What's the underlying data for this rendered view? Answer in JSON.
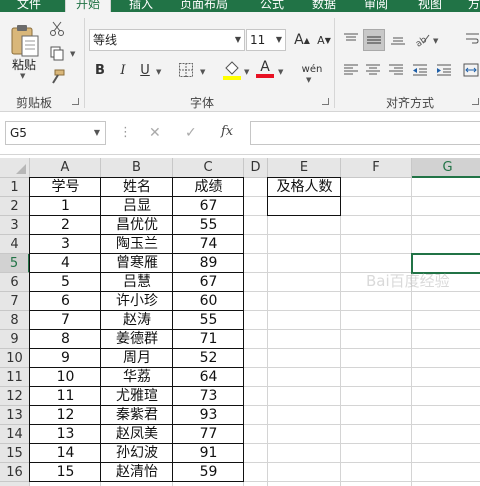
{
  "tabs": [
    "文件",
    "开始",
    "插入",
    "页面布局",
    "公式",
    "数据",
    "审阅",
    "视图",
    "方"
  ],
  "active_tab": "开始",
  "ribbon": {
    "clipboard_label": "剪贴板",
    "paste_label": "粘贴",
    "font_label": "字体",
    "align_label": "对齐方式",
    "font_name": "等线",
    "font_size": "11",
    "bold": "B",
    "italic": "I",
    "underline": "U",
    "font_color_glyph": "A",
    "phonetic_glyph": "wén",
    "grow_glyph": "A",
    "shrink_glyph": "A",
    "font_color": "#e81123",
    "fill_color": "#ffff00"
  },
  "formula_bar": {
    "name_box": "G5",
    "cancel": "✕",
    "enter": "✓",
    "fx": "fx",
    "formula": ""
  },
  "columns": [
    "A",
    "B",
    "C",
    "D",
    "E",
    "F",
    "G"
  ],
  "selected_column": "G",
  "selected_row": "5",
  "rows": [
    {
      "num": "1",
      "a": "学号",
      "b": "姓名",
      "c": "成绩",
      "e": "及格人数"
    },
    {
      "num": "2",
      "a": "1",
      "b": "吕显",
      "c": "67",
      "e": ""
    },
    {
      "num": "3",
      "a": "2",
      "b": "昌优优",
      "c": "55",
      "e": ""
    },
    {
      "num": "4",
      "a": "3",
      "b": "陶玉兰",
      "c": "74",
      "e": ""
    },
    {
      "num": "5",
      "a": "4",
      "b": "曾寒雁",
      "c": "89",
      "e": ""
    },
    {
      "num": "6",
      "a": "5",
      "b": "吕慧",
      "c": "67",
      "e": ""
    },
    {
      "num": "7",
      "a": "6",
      "b": "许小珍",
      "c": "60",
      "e": ""
    },
    {
      "num": "8",
      "a": "7",
      "b": "赵涛",
      "c": "55",
      "e": ""
    },
    {
      "num": "9",
      "a": "8",
      "b": "姜德群",
      "c": "71",
      "e": ""
    },
    {
      "num": "10",
      "a": "9",
      "b": "周月",
      "c": "52",
      "e": ""
    },
    {
      "num": "11",
      "a": "10",
      "b": "华荔",
      "c": "64",
      "e": ""
    },
    {
      "num": "12",
      "a": "11",
      "b": "尤雅瑄",
      "c": "73",
      "e": ""
    },
    {
      "num": "13",
      "a": "12",
      "b": "秦紫君",
      "c": "93",
      "e": ""
    },
    {
      "num": "14",
      "a": "13",
      "b": "赵凤美",
      "c": "77",
      "e": ""
    },
    {
      "num": "15",
      "a": "14",
      "b": "孙幻波",
      "c": "91",
      "e": ""
    },
    {
      "num": "16",
      "a": "15",
      "b": "赵清怡",
      "c": "59",
      "e": ""
    }
  ],
  "watermark": "Bai百度经验",
  "accent": "#217346"
}
